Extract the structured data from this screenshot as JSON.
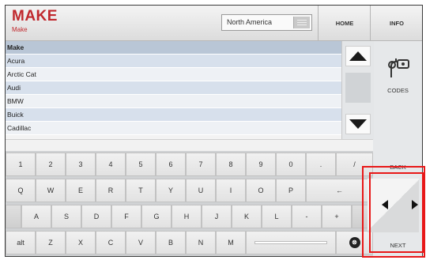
{
  "header": {
    "title": "MAKE",
    "subtitle": "Make",
    "region_value": "North America",
    "home_label": "HOME",
    "info_label": "INFO"
  },
  "list": {
    "column_header": "Make",
    "items": [
      "Acura",
      "Arctic Cat",
      "Audi",
      "BMW",
      "Buick",
      "Cadillac"
    ]
  },
  "side": {
    "codes_label": "CODES",
    "back_label": "BACK",
    "next_label": "NEXT"
  },
  "keyboard": {
    "row1": [
      "1",
      "2",
      "3",
      "4",
      "5",
      "6",
      "7",
      "8",
      "9",
      "0",
      ".",
      "/"
    ],
    "row2": [
      "Q",
      "W",
      "E",
      "R",
      "T",
      "Y",
      "U",
      "I",
      "O",
      "P",
      "←"
    ],
    "row3": [
      "A",
      "S",
      "D",
      "F",
      "G",
      "H",
      "J",
      "K",
      "L",
      "-",
      "+"
    ],
    "row4": [
      "alt",
      "Z",
      "X",
      "C",
      "V",
      "B",
      "N",
      "M"
    ],
    "clear_symbol": "⊗"
  },
  "colors": {
    "brand_red": "#c0282d",
    "list_header_bg": "#b9c6d6",
    "annotation_red": "#e81818"
  },
  "icons": {
    "region_menu": "menu-lines-icon",
    "scroll_up": "triangle-up-icon",
    "scroll_down": "triangle-down-icon",
    "codes": "key-card-icon",
    "nav_left": "triangle-left-icon",
    "nav_right": "triangle-right-icon",
    "clear": "clear-circle-icon"
  }
}
